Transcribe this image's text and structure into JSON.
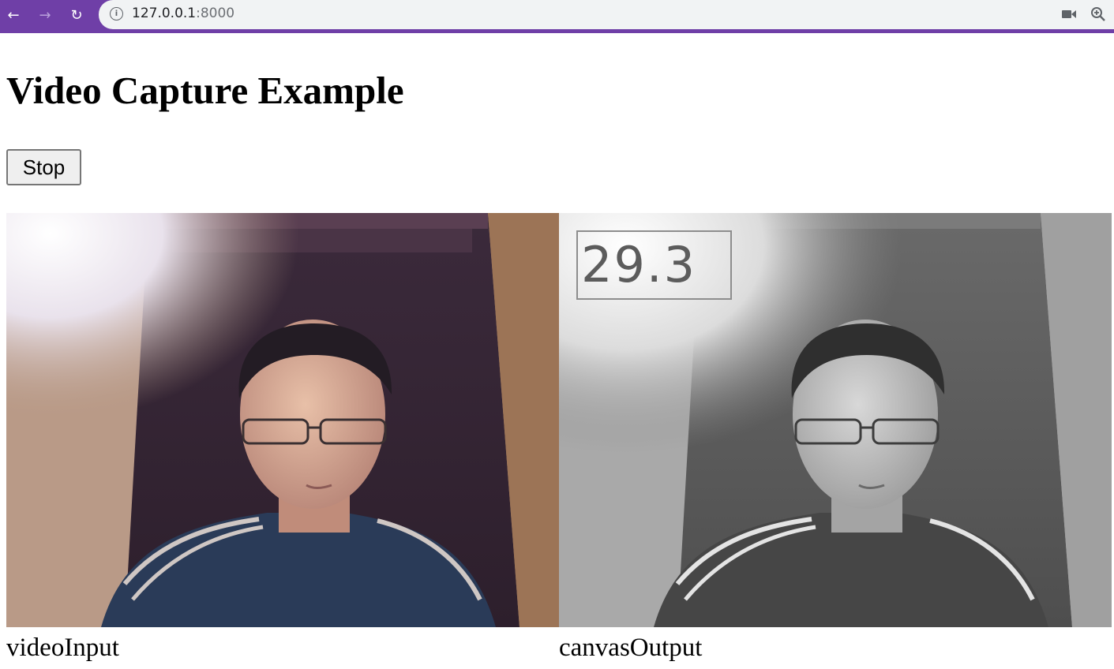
{
  "browser": {
    "url_host": "127.0.0.1",
    "url_port": ":8000",
    "icons": {
      "back": "arrow-left-icon",
      "forward": "arrow-right-icon",
      "reload": "reload-icon",
      "info": "info-icon",
      "camera": "camera-icon",
      "zoom": "zoom-icon"
    },
    "accent_color": "#6f3fa7"
  },
  "page": {
    "title": "Video Capture Example",
    "stop_label": "Stop",
    "video_input_caption": "videoInput",
    "canvas_output_caption": "canvasOutput",
    "fps_value": "29.3"
  }
}
